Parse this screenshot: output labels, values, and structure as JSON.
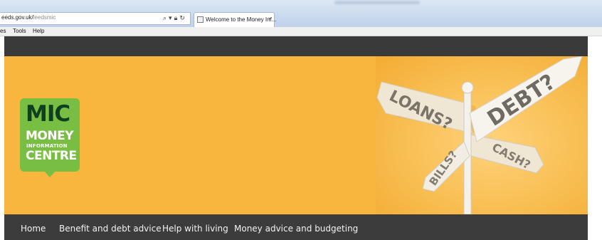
{
  "browser": {
    "address_prefix": "eeds.gov.uk/",
    "address_rest": "leedsmic",
    "address_icons": [
      "search-icon",
      "dropdown-icon",
      "lock-icon",
      "refresh-icon"
    ],
    "tab_title": "Welcome to the Money Inf...",
    "tab_close": "×",
    "menu": [
      "es",
      "Tools",
      "Help"
    ]
  },
  "logo": {
    "line1": "MIC",
    "line2": "MONEY",
    "line3": "INFORMATION",
    "line4": "CENTRE",
    "color": "#78be43",
    "dark_color": "#0f3f20"
  },
  "signpost": {
    "signs": [
      "LOANS?",
      "DEBT?",
      "BILLS?",
      "CASH?"
    ]
  },
  "nav": {
    "items": [
      "Home",
      "Benefit and debt advice",
      "Help with living",
      "Money advice and budgeting"
    ]
  },
  "colors": {
    "banner": "#f8b63f",
    "dark_bar": "#3a3a3b"
  }
}
